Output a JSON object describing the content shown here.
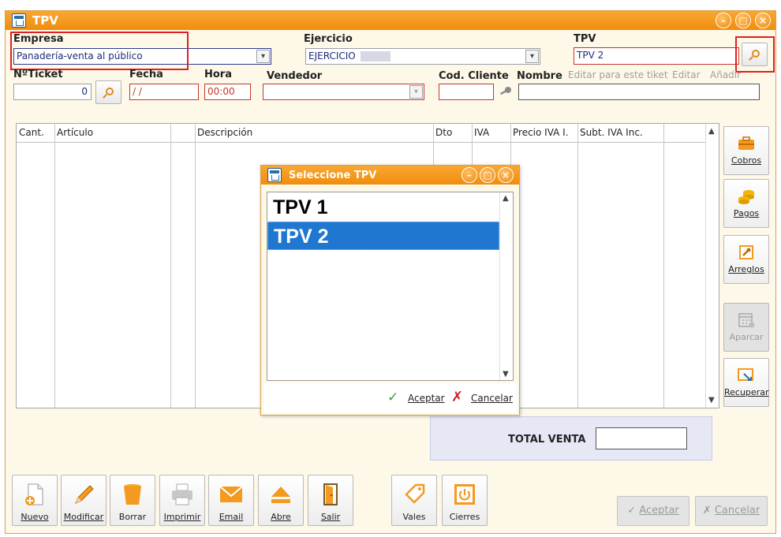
{
  "window": {
    "title": "TPV"
  },
  "form": {
    "empresa_label": "Empresa",
    "empresa_value": "Panadería-venta al público",
    "ejercicio_label": "Ejercicio",
    "ejercicio_value": "EJERCICIO",
    "tpv_label": "TPV",
    "tpv_value": "TPV 2",
    "ticket_label": "NºTicket",
    "ticket_value": "0",
    "fecha_label": "Fecha",
    "fecha_value": " / /",
    "hora_label": "Hora",
    "hora_value": "00:00",
    "vendedor_label": "Vendedor",
    "vendedor_value": "",
    "codcliente_label": "Cod. Cliente",
    "codcliente_value": "",
    "nombre_label": "Nombre",
    "nombre_value": "",
    "editar_tiket": "Editar para este tiket",
    "editar": "Editar",
    "anadir": "Añadir"
  },
  "grid": {
    "columns": [
      "Cant.",
      "Artículo",
      "",
      "Descripción",
      "Dto",
      "IVA",
      "Precio IVA I.",
      "Subt. IVA Inc.",
      ""
    ]
  },
  "side_buttons": [
    {
      "label": "Cobros",
      "icon": "briefcase-icon",
      "enabled": true
    },
    {
      "label": "Pagos",
      "icon": "coins-icon",
      "enabled": true
    },
    {
      "label": "Arreglos",
      "icon": "wrench-icon",
      "enabled": true
    },
    {
      "label": "Aparcar",
      "icon": "calendar-icon",
      "enabled": false
    },
    {
      "label": "Recuperar",
      "icon": "recover-icon",
      "enabled": true
    }
  ],
  "total": {
    "label": "TOTAL VENTA",
    "value": ""
  },
  "toolbar": [
    {
      "label": "Nuevo",
      "icon": "new-doc-icon"
    },
    {
      "label": "Modificar",
      "icon": "pencil-icon"
    },
    {
      "label": "Borrar",
      "icon": "trash-icon"
    },
    {
      "label": "Imprimir",
      "icon": "printer-icon"
    },
    {
      "label": "Email",
      "icon": "email-icon"
    },
    {
      "label": "Abre",
      "icon": "eject-icon"
    },
    {
      "label": "Salir",
      "icon": "exit-door-icon"
    },
    {
      "label": "Vales",
      "icon": "tag-icon"
    },
    {
      "label": "Cierres",
      "icon": "power-icon"
    }
  ],
  "footer_buttons": {
    "aceptar": "Aceptar",
    "cancelar": "Cancelar"
  },
  "dialog": {
    "title": "Seleccione TPV",
    "items": [
      "TPV 1",
      "TPV 2"
    ],
    "selected_index": 1,
    "aceptar": "Aceptar",
    "cancelar": "Cancelar"
  },
  "colors": {
    "accent": "#f39a1f",
    "selection": "#1f77d0",
    "highlight": "#e02020"
  }
}
